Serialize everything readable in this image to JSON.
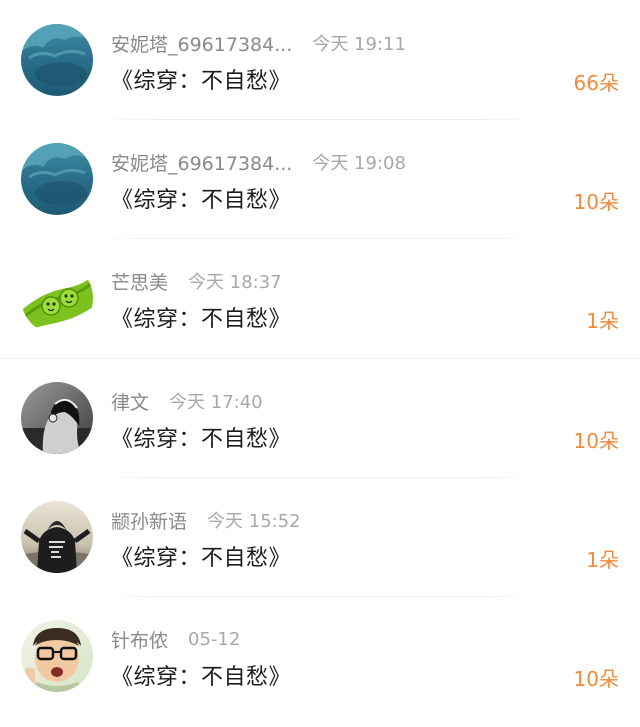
{
  "items": [
    {
      "username": "安妮塔_69617384...",
      "time": "今天 19:11",
      "title": "《综穿：不自愁》",
      "count": "66朵",
      "avatar": "ocean-avatar"
    },
    {
      "username": "安妮塔_69617384...",
      "time": "今天 19:08",
      "title": "《综穿：不自愁》",
      "count": "10朵",
      "avatar": "ocean-avatar"
    },
    {
      "username": "芒思美",
      "time": "今天 18:37",
      "title": "《综穿：不自愁》",
      "count": "1朵",
      "avatar": "green-pea-avatar"
    },
    {
      "username": "律文",
      "time": "今天 17:40",
      "title": "《综穿：不自愁》",
      "count": "10朵",
      "avatar": "headphones-girl-avatar"
    },
    {
      "username": "颛孙新语",
      "time": "今天 15:52",
      "title": "《综穿：不自愁》",
      "count": "1朵",
      "avatar": "hoodie-person-avatar"
    },
    {
      "username": "针布侬",
      "time": "05-12",
      "title": "《综穿：不自愁》",
      "count": "10朵",
      "avatar": "glasses-boy-avatar"
    }
  ],
  "colors": {
    "count": "#f08a3c",
    "username": "#8a8a8a",
    "time": "#a8a8a8",
    "title": "#1c1c1c"
  }
}
